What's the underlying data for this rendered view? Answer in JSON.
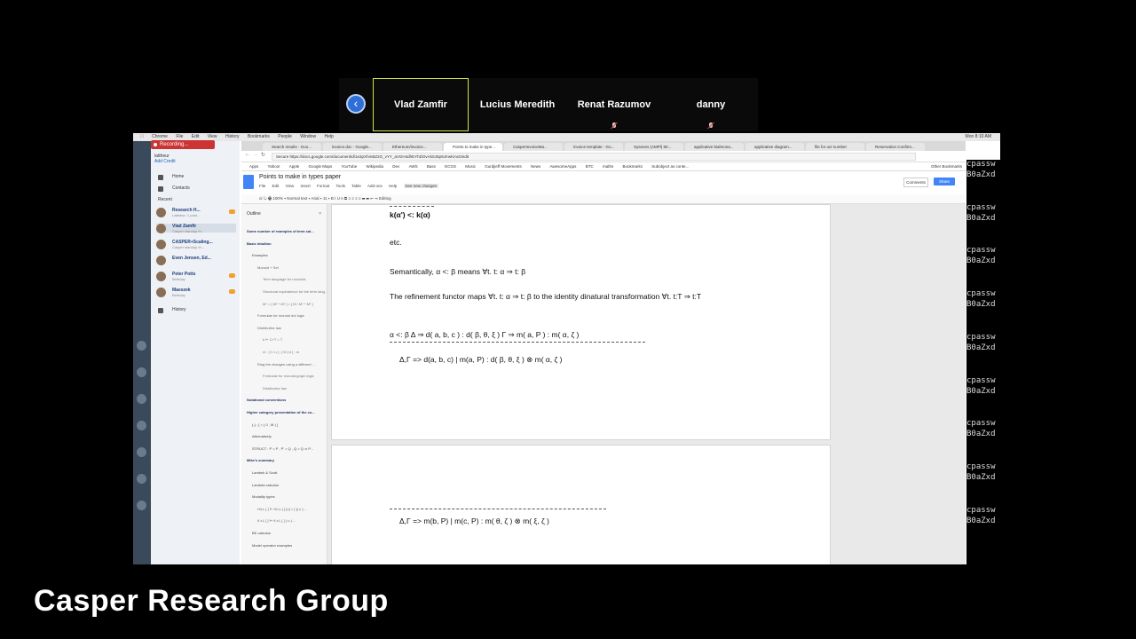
{
  "participants": [
    {
      "name": "Vlad Zamfir",
      "active": true,
      "muted": false
    },
    {
      "name": "Lucius Meredith",
      "active": false,
      "muted": false
    },
    {
      "name": "Renat Razumov",
      "active": false,
      "muted": true
    },
    {
      "name": "danny",
      "active": false,
      "muted": true
    }
  ],
  "recording_label": "Recording...",
  "mac_menubar": {
    "items": [
      "Chrome",
      "File",
      "Edit",
      "View",
      "History",
      "Bookmarks",
      "People",
      "Window",
      "Help"
    ],
    "clock": "Mon 8:10 AM"
  },
  "skype": {
    "user": "lattheur",
    "credit": "Add Credit",
    "nav": [
      "Home",
      "Contacts",
      "Recent",
      "History"
    ],
    "contacts": [
      {
        "name": "Research H...",
        "status": "Lattheur: 1 post..."
      },
      {
        "name": "Vlad Zamfir",
        "status": "Casper standup fri..."
      },
      {
        "name": "CASPER+Scaling...",
        "status": "Casper standup fri..."
      },
      {
        "name": "Even Jensen, Ed...",
        "status": ""
      },
      {
        "name": "Peter Potts",
        "status": "Birthday"
      },
      {
        "name": "Maeszek",
        "status": "Birthday"
      }
    ]
  },
  "chrome": {
    "tabs": [
      "Search results - Goo...",
      "invoice.doc - Google...",
      "Ethereum/invoice...",
      "Points to make in type...",
      "CasperInvoiceMa...",
      "invoice template - Go...",
      "Sysenes (AMPl) 80...",
      "applicative bialmona...",
      "applicative diagram...",
      "file for uni number",
      "Reservation Confirm..."
    ],
    "url": "Secure  https://docs.google.com/document/d/1e3pXhmBZ2O_vYY_aVGH4dhEYhDOvAkSJ6p9JrrwKmcIt/edit",
    "bookmarks": [
      "Apps",
      "Yahoo!",
      "Apple",
      "Google Maps",
      "YouTube",
      "Wikipedia",
      "Dev",
      "AWS",
      "Bass",
      "ECGS",
      "Music",
      "Gurdjieff Movements",
      "News",
      "AwesomeApps",
      "BTC",
      "maths",
      "Bookmarks",
      "Subobject as conte...",
      "Other Bookmarks"
    ]
  },
  "docs": {
    "title": "Points to make in types paper",
    "menu": [
      "File",
      "Edit",
      "View",
      "Insert",
      "Format",
      "Tools",
      "Table",
      "Add-ons",
      "Help",
      "See new changes"
    ],
    "comments": "Comments",
    "share": "Share",
    "toolbar": "⎌  ↻  🖶  100%  ▾  Normal text  ▾  Arial  ▾  11  ▾   B  I  U  A   ⧉  ≡  ≡  ≡  ≡   ☰  ☰  ⇤  ⇥   Editing"
  },
  "outline": {
    "header": "Outline",
    "items": [
      {
        "t": "Some number of examples of term cal...",
        "lvl": 1
      },
      {
        "t": "Basic intuition",
        "lvl": 1
      },
      {
        "t": "Examples",
        "lvl": 2
      },
      {
        "t": "Monoid + Set",
        "lvl": 3
      },
      {
        "t": "Term language for monoids",
        "lvl": 4
      },
      {
        "t": "Structural equivalence for the term lang...",
        "lvl": 4
      },
      {
        "t": "M* = [ M* * M* ] = [ M / M* * M* ]",
        "lvl": 4
      },
      {
        "t": "Formulae for monoid dot logic",
        "lvl": 3
      },
      {
        "t": "Distributive law",
        "lvl": 3
      },
      {
        "t": "k ⊢ C+T = T",
        "lvl": 4
      },
      {
        "t": "m : [ f / u ] : [ M | d ] : m",
        "lvl": 4
      },
      {
        "t": "Ring the changes using a different ...",
        "lvl": 3
      },
      {
        "t": "Formulae for monoid-graph logic",
        "lvl": 4
      },
      {
        "t": "Distributive law",
        "lvl": 4
      },
      {
        "t": "Notational conventions",
        "lvl": 1
      },
      {
        "t": "Higher category presentation of the co...",
        "lvl": 1
      },
      {
        "t": "(-) : [ = ( 0 , M ) ]",
        "lvl": 2
      },
      {
        "t": "Alternatively",
        "lvl": 2
      },
      {
        "t": "STRUCT : P = P , P' = Q , Q = Q ⇒ P...",
        "lvl": 2
      },
      {
        "t": "Mike's summary",
        "lvl": 1
      },
      {
        "t": "Lambek & Scott",
        "lvl": 2
      },
      {
        "t": "Lambda calculus",
        "lvl": 2
      },
      {
        "t": "Modality types",
        "lvl": 2
      },
      {
        "t": "H/r,L        [ ] ⊢ H/r,L [ ] [u] = [ ]( u ) ...",
        "lvl": 3
      },
      {
        "t": "K:r,L        [ ] ⊢ K:r,L [ ] ( u ) ...",
        "lvl": 3
      },
      {
        "t": "BK calculus",
        "lvl": 2
      },
      {
        "t": "Model operator examples",
        "lvl": 2
      }
    ]
  },
  "page1_lines": [
    "k(α') <: k(α)",
    "etc.",
    "Semantically, α  <: β means ∀t. t: α ⇒ t: β",
    "The refinement functor maps ∀t. t: α ⇒ t: β to the identity dinatural transformation ∀t. t:T ⇒  t:T",
    "α <: β   Δ ⇒ d( a, b, c ) : d( β, θ, ξ )    Γ ⇒ m( a, P ) : m( α, ζ )",
    "Δ,Γ => d(a, b, c) | m(a, P) : d( β, θ, ξ ) ⊗ m( α, ζ )"
  ],
  "page2_lines": [
    "Δ,Γ => m(b, P) | m(c, P) : m( θ, ζ ) ⊗ m( ξ, ζ )"
  ],
  "terminal_lines": [
    "cpassw",
    "B0aZxd",
    "cpassw",
    "B0aZxd",
    "cpassw",
    "B0aZxd",
    "cpassw",
    "B0aZxd",
    "cpassw",
    "B0aZxd",
    "cpassw",
    "B0aZxd",
    "cpassw",
    "B0aZxd",
    "cpassw",
    "B0aZxd",
    "cpassw",
    "B0aZxd"
  ],
  "caption": "Casper Research Group"
}
